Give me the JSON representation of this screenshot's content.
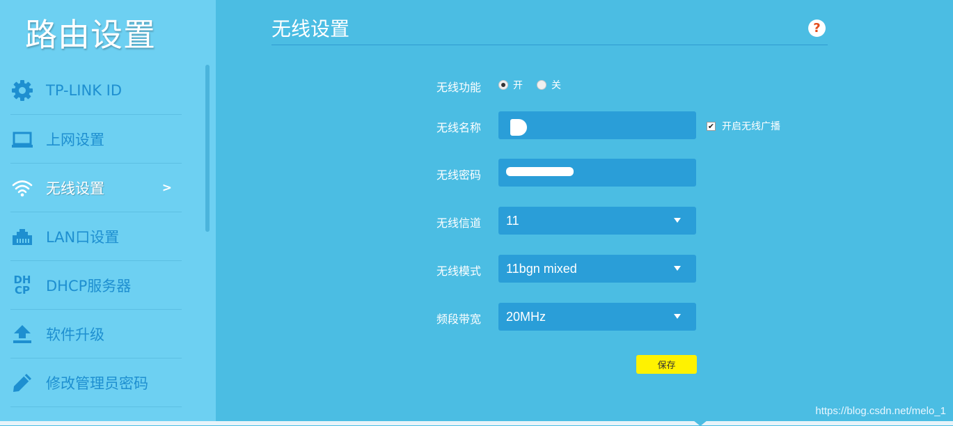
{
  "sidebar": {
    "title": "路由设置",
    "items": [
      {
        "label": "TP-LINK ID",
        "icon": "gear-icon"
      },
      {
        "label": "上网设置",
        "icon": "laptop-icon"
      },
      {
        "label": "无线设置",
        "icon": "wifi-icon",
        "active": true,
        "chevron": ">"
      },
      {
        "label": "LAN口设置",
        "icon": "lan-port-icon"
      },
      {
        "label": "DHCP服务器",
        "icon": "dhcp-icon",
        "icon_text": [
          "DH",
          "CP"
        ]
      },
      {
        "label": "软件升级",
        "icon": "upload-icon"
      },
      {
        "label": "修改管理员密码",
        "icon": "pencil-icon"
      }
    ]
  },
  "main": {
    "title": "无线设置",
    "help": "?",
    "form": {
      "wireless_function": {
        "label": "无线功能",
        "on_label": "开",
        "off_label": "关",
        "selected": "开"
      },
      "ssid": {
        "label": "无线名称",
        "value": "",
        "broadcast_label": "开启无线广播",
        "broadcast_checked": true
      },
      "password": {
        "label": "无线密码",
        "value": ""
      },
      "channel": {
        "label": "无线信道",
        "value": "11"
      },
      "mode": {
        "label": "无线模式",
        "value": "11bgn mixed"
      },
      "bandwidth": {
        "label": "频段带宽",
        "value": "20MHz"
      },
      "save_label": "保存"
    }
  },
  "watermark": "https://blog.csdn.net/melo_1",
  "colors": {
    "background": "#4bbde3",
    "sidebar": "#6dd0f2",
    "field": "#2a9ed8",
    "accent_text": "#1e8fd0",
    "save_button": "#fff200"
  }
}
